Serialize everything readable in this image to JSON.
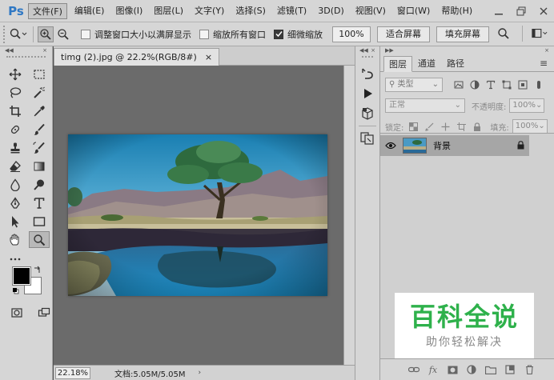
{
  "app": {
    "logo": "Ps"
  },
  "menu": [
    {
      "label": "文件(F)",
      "active": true
    },
    {
      "label": "编辑(E)"
    },
    {
      "label": "图像(I)"
    },
    {
      "label": "图层(L)"
    },
    {
      "label": "文字(Y)"
    },
    {
      "label": "选择(S)"
    },
    {
      "label": "滤镜(T)"
    },
    {
      "label": "3D(D)"
    },
    {
      "label": "视图(V)"
    },
    {
      "label": "窗口(W)"
    },
    {
      "label": "帮助(H)"
    }
  ],
  "options": {
    "resize_windows": "调整窗口大小以满屏显示",
    "zoom_all": "缩放所有窗口",
    "scrubby_zoom": "细微缩放",
    "zoom_percent": "100%",
    "fit_screen": "适合屏幕",
    "fill_screen": "填充屏幕"
  },
  "document": {
    "tab_title": "timg (2).jpg @ 22.2%(RGB/8#)",
    "close": "×",
    "zoom": "22.18%",
    "info": "文档:5.05M/5.05M",
    "arrow": "›"
  },
  "layers_panel": {
    "tabs": [
      "图层",
      "通道",
      "路径"
    ],
    "kind_label": "类型",
    "blend_mode": "正常",
    "opacity_label": "不透明度:",
    "opacity_value": "100%",
    "lock_label": "锁定:",
    "fill_label": "填充:",
    "fill_value": "100%",
    "layer_name": "背景"
  },
  "watermark": {
    "title": "百科全说",
    "subtitle": "助你轻松解决"
  },
  "colors": {
    "ps_blue": "#2f78c4",
    "watermark_green": "#2eb14b"
  }
}
